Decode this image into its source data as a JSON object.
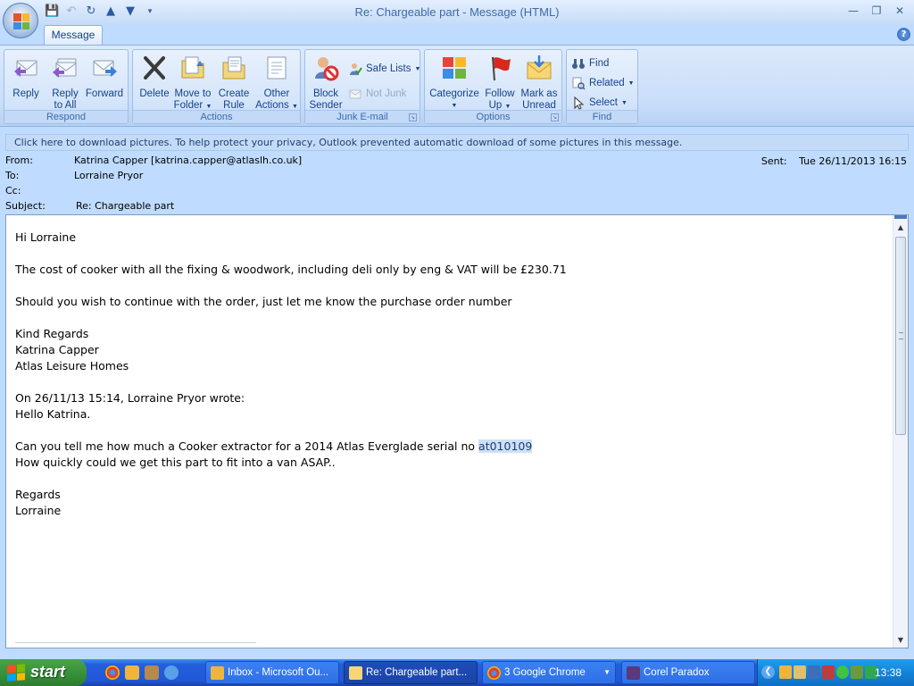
{
  "window": {
    "title": "Re: Chargeable part - Message (HTML)"
  },
  "ribbon": {
    "tab": "Message",
    "groups": {
      "respond": {
        "label": "Respond",
        "reply": "Reply",
        "reply_all_1": "Reply",
        "reply_all_2": "to All",
        "forward": "Forward"
      },
      "actions": {
        "label": "Actions",
        "delete": "Delete",
        "move_1": "Move to",
        "move_2": "Folder",
        "rule_1": "Create",
        "rule_2": "Rule",
        "other_1": "Other",
        "other_2": "Actions"
      },
      "junk": {
        "label": "Junk E-mail",
        "block_1": "Block",
        "block_2": "Sender",
        "safe_lists": "Safe Lists",
        "not_junk": "Not Junk"
      },
      "options": {
        "label": "Options",
        "categorize": "Categorize",
        "follow_1": "Follow",
        "follow_2": "Up",
        "mark_1": "Mark as",
        "mark_2": "Unread"
      },
      "find": {
        "label": "Find",
        "find": "Find",
        "related": "Related",
        "select": "Select"
      }
    }
  },
  "infobar": "Click here to download pictures. To help protect your privacy, Outlook prevented automatic download of some pictures in this message.",
  "header": {
    "from_label": "From:",
    "from": "Katrina Capper [katrina.capper@atlaslh.co.uk]",
    "to_label": "To:",
    "to": "Lorraine Pryor",
    "cc_label": "Cc:",
    "cc": "",
    "subject_label": "Subject:",
    "subject": "Re: Chargeable part",
    "sent_label": "Sent:",
    "sent": "Tue 26/11/2013 16:15"
  },
  "body": {
    "greeting": "Hi Lorraine",
    "cost": "The cost of cooker with all the fixing & woodwork, including deli only by eng & VAT will be £230.71",
    "order": "Should you wish to continue with the order, just let me know the purchase order number",
    "regards": "Kind Regards",
    "sig_name": "Katrina Capper",
    "sig_company": "Atlas Leisure Homes",
    "quote_header": "On 26/11/13 15:14, Lorraine Pryor wrote:",
    "quote_greeting": "Hello Katrina.",
    "quote_q1_prefix": "Can you tell me how much a Cooker extractor for a 2014 Atlas Everglade serial no ",
    "quote_q1_serial": "at010109",
    "quote_q2": "How quickly could we get this part to fit into a van ASAP..",
    "quote_regards": "Regards",
    "quote_name": "Lorraine"
  },
  "taskbar": {
    "start": "start",
    "tasks": [
      {
        "label": "Inbox - Microsoft Ou..."
      },
      {
        "label": "Re: Chargeable part..."
      },
      {
        "label": "3 Google Chrome"
      },
      {
        "label": "Corel Paradox"
      }
    ],
    "clock": "13:38"
  }
}
